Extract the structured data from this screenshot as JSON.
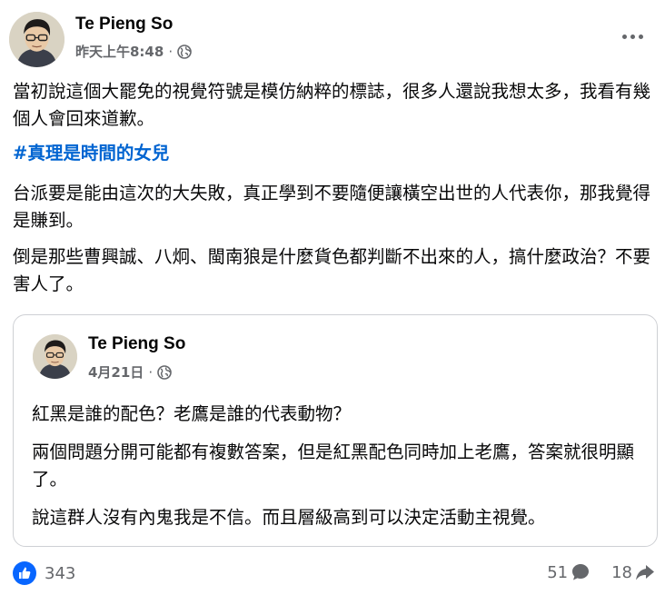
{
  "post": {
    "author": "Te Pieng So",
    "timestamp": "昨天上午8:48",
    "separator": "·",
    "privacy_icon": "globe-icon",
    "more_icon": "more-options-icon",
    "paragraphs": {
      "p1": "當初說這個大罷免的視覺符號是模仿納粹的標誌，很多人還說我想太多，我看有幾個人會回來道歉。",
      "hashtag": "#真理是時間的女兒",
      "p2": "台派要是能由這次的大失敗，真正學到不要隨便讓橫空出世的人代表你，那我覺得是賺到。",
      "p3": "倒是那些曹興誠、八炯、閩南狼是什麼貨色都判斷不出來的人，搞什麼政治？不要害人了。"
    }
  },
  "shared_post": {
    "author": "Te Pieng So",
    "timestamp": "4月21日",
    "separator": "·",
    "privacy_icon": "globe-icon",
    "paragraphs": {
      "p1": "紅黑是誰的配色？老鷹是誰的代表動物？",
      "p2": "兩個問題分開可能都有複數答案，但是紅黑配色同時加上老鷹，答案就很明顯了。",
      "p3": "說這群人沒有內鬼我是不信。而且層級高到可以決定活動主視覺。"
    }
  },
  "footer": {
    "like_count": "343",
    "comment_count": "51",
    "share_count": "18",
    "like_icon": "like-icon",
    "comment_icon": "comment-icon",
    "share_icon": "share-icon"
  },
  "colors": {
    "hashtag": "#0064d1",
    "like_blue": "#0866ff",
    "secondary_text": "#65676b",
    "border": "#ced0d4"
  }
}
